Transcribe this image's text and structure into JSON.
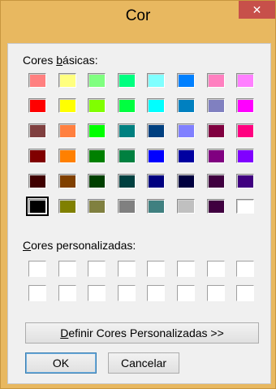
{
  "window": {
    "title": "Cor",
    "close_glyph": "✕"
  },
  "labels": {
    "basic_prefix": "Cores ",
    "basic_accel": "b",
    "basic_suffix": "ásicas:",
    "custom_accel": "C",
    "custom_suffix": "ores personalizadas:"
  },
  "buttons": {
    "define_accel": "D",
    "define_suffix": "efinir Cores Personalizadas >>",
    "ok": "OK",
    "cancel": "Cancelar"
  },
  "basic_colors": [
    [
      "#ff8080",
      "#ffff80",
      "#80ff80",
      "#00ff80",
      "#80ffff",
      "#0080ff",
      "#ff80c0",
      "#ff80ff"
    ],
    [
      "#ff0000",
      "#ffff00",
      "#80ff00",
      "#00ff40",
      "#00ffff",
      "#0080c0",
      "#8080c0",
      "#ff00ff"
    ],
    [
      "#804040",
      "#ff8040",
      "#00ff00",
      "#008080",
      "#004080",
      "#8080ff",
      "#800040",
      "#ff0080"
    ],
    [
      "#800000",
      "#ff8000",
      "#008000",
      "#008040",
      "#0000ff",
      "#0000a0",
      "#800080",
      "#8000ff"
    ],
    [
      "#400000",
      "#804000",
      "#004000",
      "#004040",
      "#000080",
      "#000040",
      "#400040",
      "#400080"
    ],
    [
      "#000000",
      "#808000",
      "#808040",
      "#808080",
      "#408080",
      "#c0c0c0",
      "#400040",
      "#ffffff"
    ]
  ],
  "selected_color": "#000000",
  "custom_colors": [
    [
      "#ffffff",
      "#ffffff",
      "#ffffff",
      "#ffffff",
      "#ffffff",
      "#ffffff",
      "#ffffff",
      "#ffffff"
    ],
    [
      "#ffffff",
      "#ffffff",
      "#ffffff",
      "#ffffff",
      "#ffffff",
      "#ffffff",
      "#ffffff",
      "#ffffff"
    ]
  ]
}
